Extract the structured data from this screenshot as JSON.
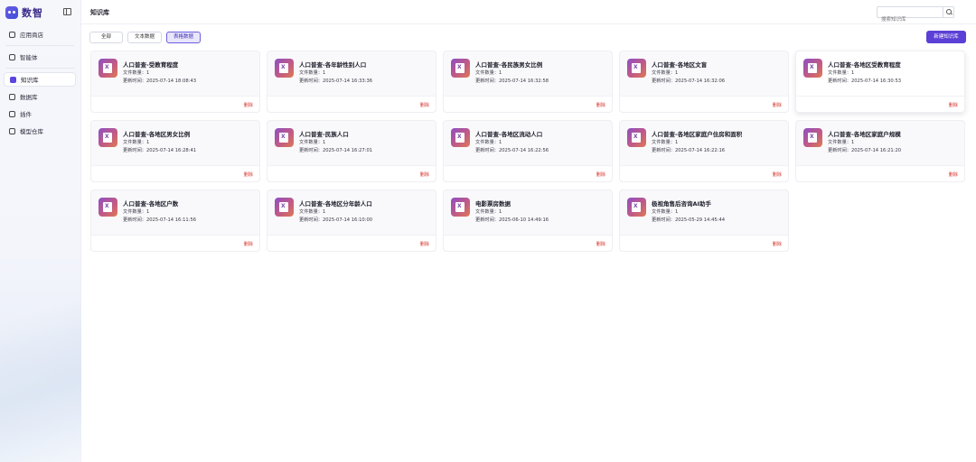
{
  "sidebar": {
    "brand": "数智",
    "items": [
      {
        "label": "应用商店",
        "icon": "store-icon"
      },
      {
        "label": "智能体",
        "icon": "agent-icon"
      },
      {
        "label": "知识库",
        "icon": "book-icon",
        "active": true
      },
      {
        "label": "数据库",
        "icon": "database-icon"
      },
      {
        "label": "插件",
        "icon": "plugin-icon"
      },
      {
        "label": "模型仓库",
        "icon": "model-icon"
      }
    ]
  },
  "header": {
    "title": "知识库",
    "search_placeholder": "搜索知识库"
  },
  "filters": {
    "tabs": [
      "全部",
      "文本数据",
      "表格数据"
    ],
    "active_tab": "表格数据"
  },
  "actions": {
    "new_label": "新建知识库"
  },
  "labels": {
    "file_count": "文件数量：",
    "updated": "更新时间：",
    "delete": "删除"
  },
  "cards": [
    {
      "title": "人口普查-受教育程度",
      "count": "1",
      "updated": "2025-07-14 18:08:43"
    },
    {
      "title": "人口普查-各年龄性别人口",
      "count": "1",
      "updated": "2025-07-14 16:33:36"
    },
    {
      "title": "人口普查-各民族男女比例",
      "count": "1",
      "updated": "2025-07-14 16:32:58"
    },
    {
      "title": "人口普查-各地区文盲",
      "count": "1",
      "updated": "2025-07-14 16:32:06"
    },
    {
      "title": "人口普查-各地区受教育程度",
      "count": "1",
      "updated": "2025-07-14 16:30:53"
    },
    {
      "title": "人口普查-各地区男女比例",
      "count": "1",
      "updated": "2025-07-14 16:28:41"
    },
    {
      "title": "人口普查-民族人口",
      "count": "1",
      "updated": "2025-07-14 16:27:01"
    },
    {
      "title": "人口普查-各地区流动人口",
      "count": "1",
      "updated": "2025-07-14 16:22:56"
    },
    {
      "title": "人口普查-各地区家庭户住房和面积",
      "count": "1",
      "updated": "2025-07-14 16:22:16"
    },
    {
      "title": "人口普查-各地区家庭户规模",
      "count": "1",
      "updated": "2025-07-14 16:21:20"
    },
    {
      "title": "人口普查-各地区户数",
      "count": "1",
      "updated": "2025-07-14 16:11:56"
    },
    {
      "title": "人口普查-各地区分年龄人口",
      "count": "1",
      "updated": "2025-07-14 16:10:00"
    },
    {
      "title": "电影票房数据",
      "count": "1",
      "updated": "2025-06-10 14:49:16"
    },
    {
      "title": "极视角售后咨询AI助手",
      "count": "1",
      "updated": "2025-05-29 14:45:44"
    }
  ]
}
